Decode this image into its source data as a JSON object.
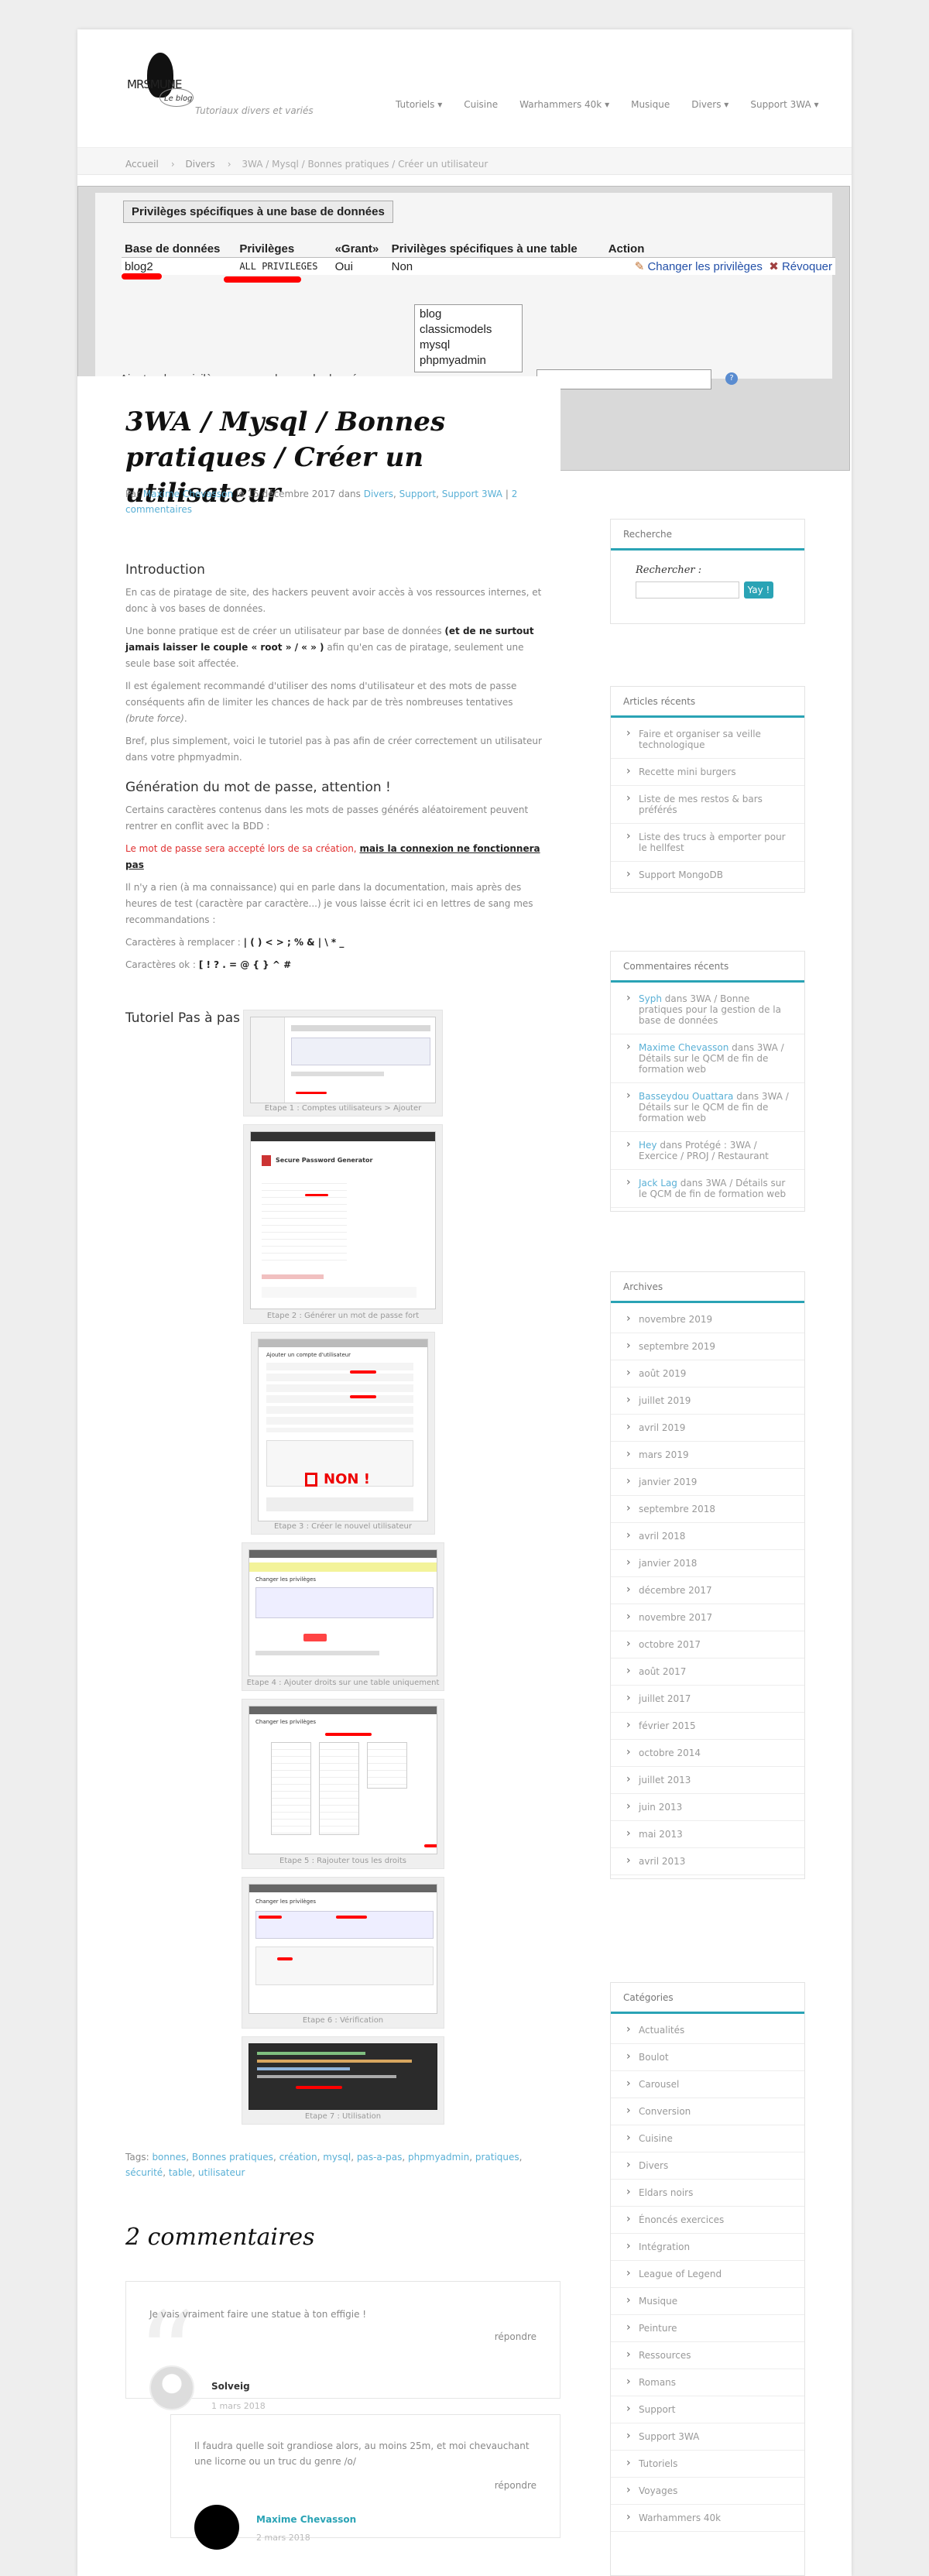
{
  "site": {
    "name": "MRSMUNE",
    "logo_sub": "Le blog",
    "tagline": "Tutoriaux divers et variés"
  },
  "nav": [
    "Tutoriels ▾",
    "Cuisine",
    "Warhammers 40k ▾",
    "Musique",
    "Divers ▾",
    "Support 3WA ▾"
  ],
  "breadcrumb": [
    "Accueil",
    "Divers",
    "3WA / Mysql / Bonnes pratiques / Créer un utilisateur"
  ],
  "screenshot": {
    "title": "Privilèges spécifiques à une base de données",
    "headers": [
      "Base de données",
      "Privilèges",
      "«Grant»",
      "Privilèges spécifiques à une table",
      "Action"
    ],
    "row": [
      "blog2",
      "ALL PRIVILEGES",
      "Oui",
      "Non"
    ],
    "actions": [
      "Changer les privilèges",
      "Révoquer"
    ],
    "db_options": [
      "blog",
      "classicmodels",
      "mysql",
      "phpmyadmin"
    ],
    "add_label": "Ajouter des privilèges sur ces bases de données :",
    "help": "?"
  },
  "post": {
    "title": "3WA / Mysql / Bonnes pratiques / Créer un utilisateur",
    "meta": {
      "by": "Par",
      "author": "Maxime Chevasson",
      "date": "le 15 décembre 2017 dans",
      "cat1": "Divers",
      "cat2": "Support",
      "cat3": "Support 3WA",
      "comments": "2 commentaires"
    },
    "h_intro": "Introduction",
    "p1": "En cas de piratage de site, des hackers peuvent avoir accès à vos ressources internes, et donc à vos bases de données.",
    "p2a": "Une bonne pratique est de créer un utilisateur par base de données ",
    "p2b": "(et de ne surtout jamais laisser le couple « root » / « » )",
    "p2c": " afin qu'en cas de piratage, seulement une seule base soit affectée.",
    "p3a": "Il est également recommandé d'utiliser des noms d'utilisateur et des mots de passe conséquents afin de limiter les chances de hack par de très nombreuses tentatives ",
    "p3b": "(brute force)",
    "p3c": ".",
    "p4": "Bref, plus simplement, voici le tutoriel pas à pas afin de créer correctement un utilisateur dans votre phpmyadmin.",
    "h_gen": "Génération du mot de passe, attention !",
    "p5": "Certains caractères contenus dans les mots de passes générés aléatoirement peuvent rentrer en conflit avec la BDD :",
    "p6a": "Le mot de passe sera accepté lors de sa création,",
    "p6b": "mais la connexion ne fonctionnera pas",
    "p7": "Il n'y a rien (à ma connaissance) qui en parle dans la documentation, mais après des heures de test (caractère par caractère...) je vous laisse écrit ici en lettres de sang mes recommandations :",
    "rep_label": "Caractères à remplacer :",
    "rep_chars": "| ( ) < > ; % & | \\ * _",
    "ok_label": "Caractères ok :",
    "ok_chars": "[ ! ? . = @ { } ^ #",
    "h_tuto": "Tutoriel Pas à pas",
    "captions": [
      "Etape 1 : Comptes utilisateurs > Ajouter",
      "Etape 2 : Générer un mot de passe fort",
      "Etape 3 : Créer le nouvel utilisateur",
      "Etape 4 : Ajouter droits sur une table uniquement",
      "Etape 5 : Rajouter tous les droits",
      "Etape 6 : Vérification",
      "Etape 7 : Utilisation"
    ],
    "shot_texts": {
      "spg": "Secure Password Generator",
      "non": "NON !",
      "user_add": "Ajouter un compte d'utilisateur",
      "change": "Changer les privilèges"
    },
    "tags_label": "Tags:",
    "tags": [
      "bonnes",
      "Bonnes pratiques",
      "création",
      "mysql",
      "pas-a-pas",
      "phpmyadmin",
      "pratiques",
      "sécurité",
      "table",
      "utilisateur"
    ]
  },
  "comments": {
    "title": "2 commentaires",
    "items": [
      {
        "text": "Je vais vraiment faire une statue à ton effigie !",
        "reply": "répondre",
        "name": "Solveig",
        "date": "1 mars 2018"
      },
      {
        "text": "Il faudra quelle soit grandiose alors, au moins 25m, et moi chevauchant une licorne ou un truc du genre /o/",
        "reply": "répondre",
        "name": "Maxime Chevasson",
        "date": "2 mars 2018"
      }
    ]
  },
  "sidebar": {
    "search": {
      "title": "Recherche",
      "label": "Rechercher :",
      "button": "Yay !"
    },
    "recent": {
      "title": "Articles récents",
      "items": [
        "Faire et organiser sa veille technologique",
        "Recette mini burgers",
        "Liste de mes restos & bars préférés",
        "Liste des trucs à emporter pour le hellfest",
        "Support MongoDB"
      ]
    },
    "recent_comments": {
      "title": "Commentaires récents",
      "items": [
        {
          "author": "Syph",
          "mid": " dans ",
          "post": "3WA / Bonne pratiques pour la gestion de la base de données"
        },
        {
          "author": "Maxime Chevasson",
          "mid": " dans ",
          "post": "3WA / Détails sur le QCM de fin de formation web"
        },
        {
          "author": "Basseydou Ouattara",
          "mid": " dans ",
          "post": "3WA / Détails sur le QCM de fin de formation web"
        },
        {
          "author": "Hey",
          "mid": " dans ",
          "post": "Protégé : 3WA / Exercice / PROJ / Restaurant"
        },
        {
          "author": "Jack Lag",
          "mid": " dans ",
          "post": "3WA / Détails sur le QCM de fin de formation web"
        }
      ]
    },
    "archives": {
      "title": "Archives",
      "items": [
        "novembre 2019",
        "septembre 2019",
        "août 2019",
        "juillet 2019",
        "avril 2019",
        "mars 2019",
        "janvier 2019",
        "septembre 2018",
        "avril 2018",
        "janvier 2018",
        "décembre 2017",
        "novembre 2017",
        "octobre 2017",
        "août 2017",
        "juillet 2017",
        "février 2015",
        "octobre 2014",
        "juillet 2013",
        "juin 2013",
        "mai 2013",
        "avril 2013"
      ]
    },
    "categories": {
      "title": "Catégories",
      "items": [
        "Actualités",
        "Boulot",
        "Carousel",
        "Conversion",
        "Cuisine",
        "Divers",
        "Eldars noirs",
        "Énoncés exercices",
        "Intégration",
        "League of Legend",
        "Musique",
        "Peinture",
        "Ressources",
        "Romans",
        "Support",
        "Support 3WA",
        "Tutoriels",
        "Voyages",
        "Warhammers 40k"
      ]
    }
  },
  "colors": {
    "accent": "#2aa3b5",
    "link": "#5ab0d6",
    "highlight_red": "#ff0000"
  }
}
